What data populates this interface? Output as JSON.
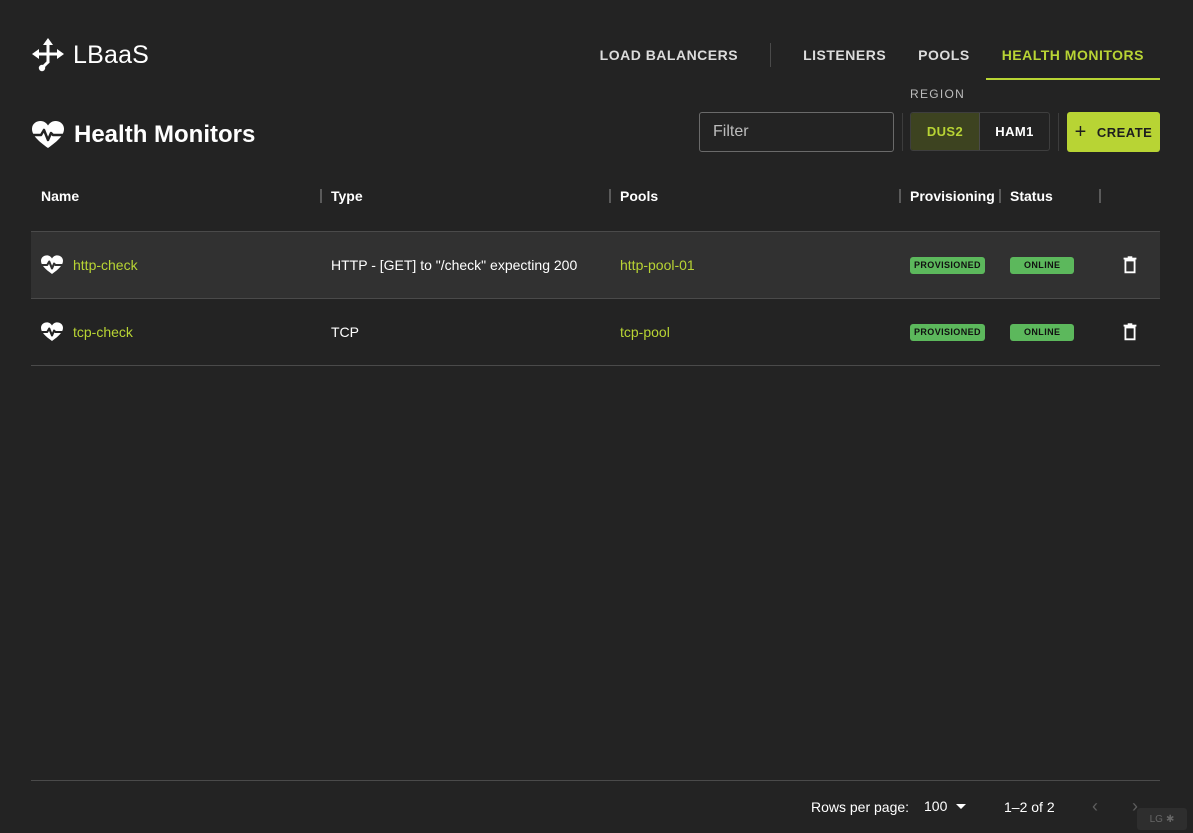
{
  "app": {
    "brand": "LBaaS"
  },
  "nav": {
    "load_balancers": "LOAD BALANCERS",
    "listeners": "LISTENERS",
    "pools": "POOLS",
    "health_monitors": "HEALTH MONITORS"
  },
  "page": {
    "title": "Health Monitors"
  },
  "toolbar": {
    "filter_placeholder": "Filter",
    "region_label": "REGION",
    "regions": [
      "DUS2",
      "HAM1"
    ],
    "selected_region": "DUS2",
    "create_label": "CREATE"
  },
  "table": {
    "columns": {
      "name": "Name",
      "type": "Type",
      "pools": "Pools",
      "provisioning": "Provisioning",
      "status": "Status"
    },
    "rows": [
      {
        "name": "http-check",
        "type": "HTTP - [GET] to \"/check\" expecting 200",
        "pool": "http-pool-01",
        "provisioning": "PROVISIONED",
        "status": "ONLINE"
      },
      {
        "name": "tcp-check",
        "type": "TCP",
        "pool": "tcp-pool",
        "provisioning": "PROVISIONED",
        "status": "ONLINE"
      }
    ]
  },
  "pagination": {
    "rows_per_page_label": "Rows per page:",
    "rows_per_page": "100",
    "range": "1–2 of 2"
  },
  "debug": {
    "tag": "LG"
  },
  "colors": {
    "background": "#232323",
    "accent": "#b8d434",
    "badge_green": "#5cb85c",
    "row_highlight": "#313131"
  }
}
